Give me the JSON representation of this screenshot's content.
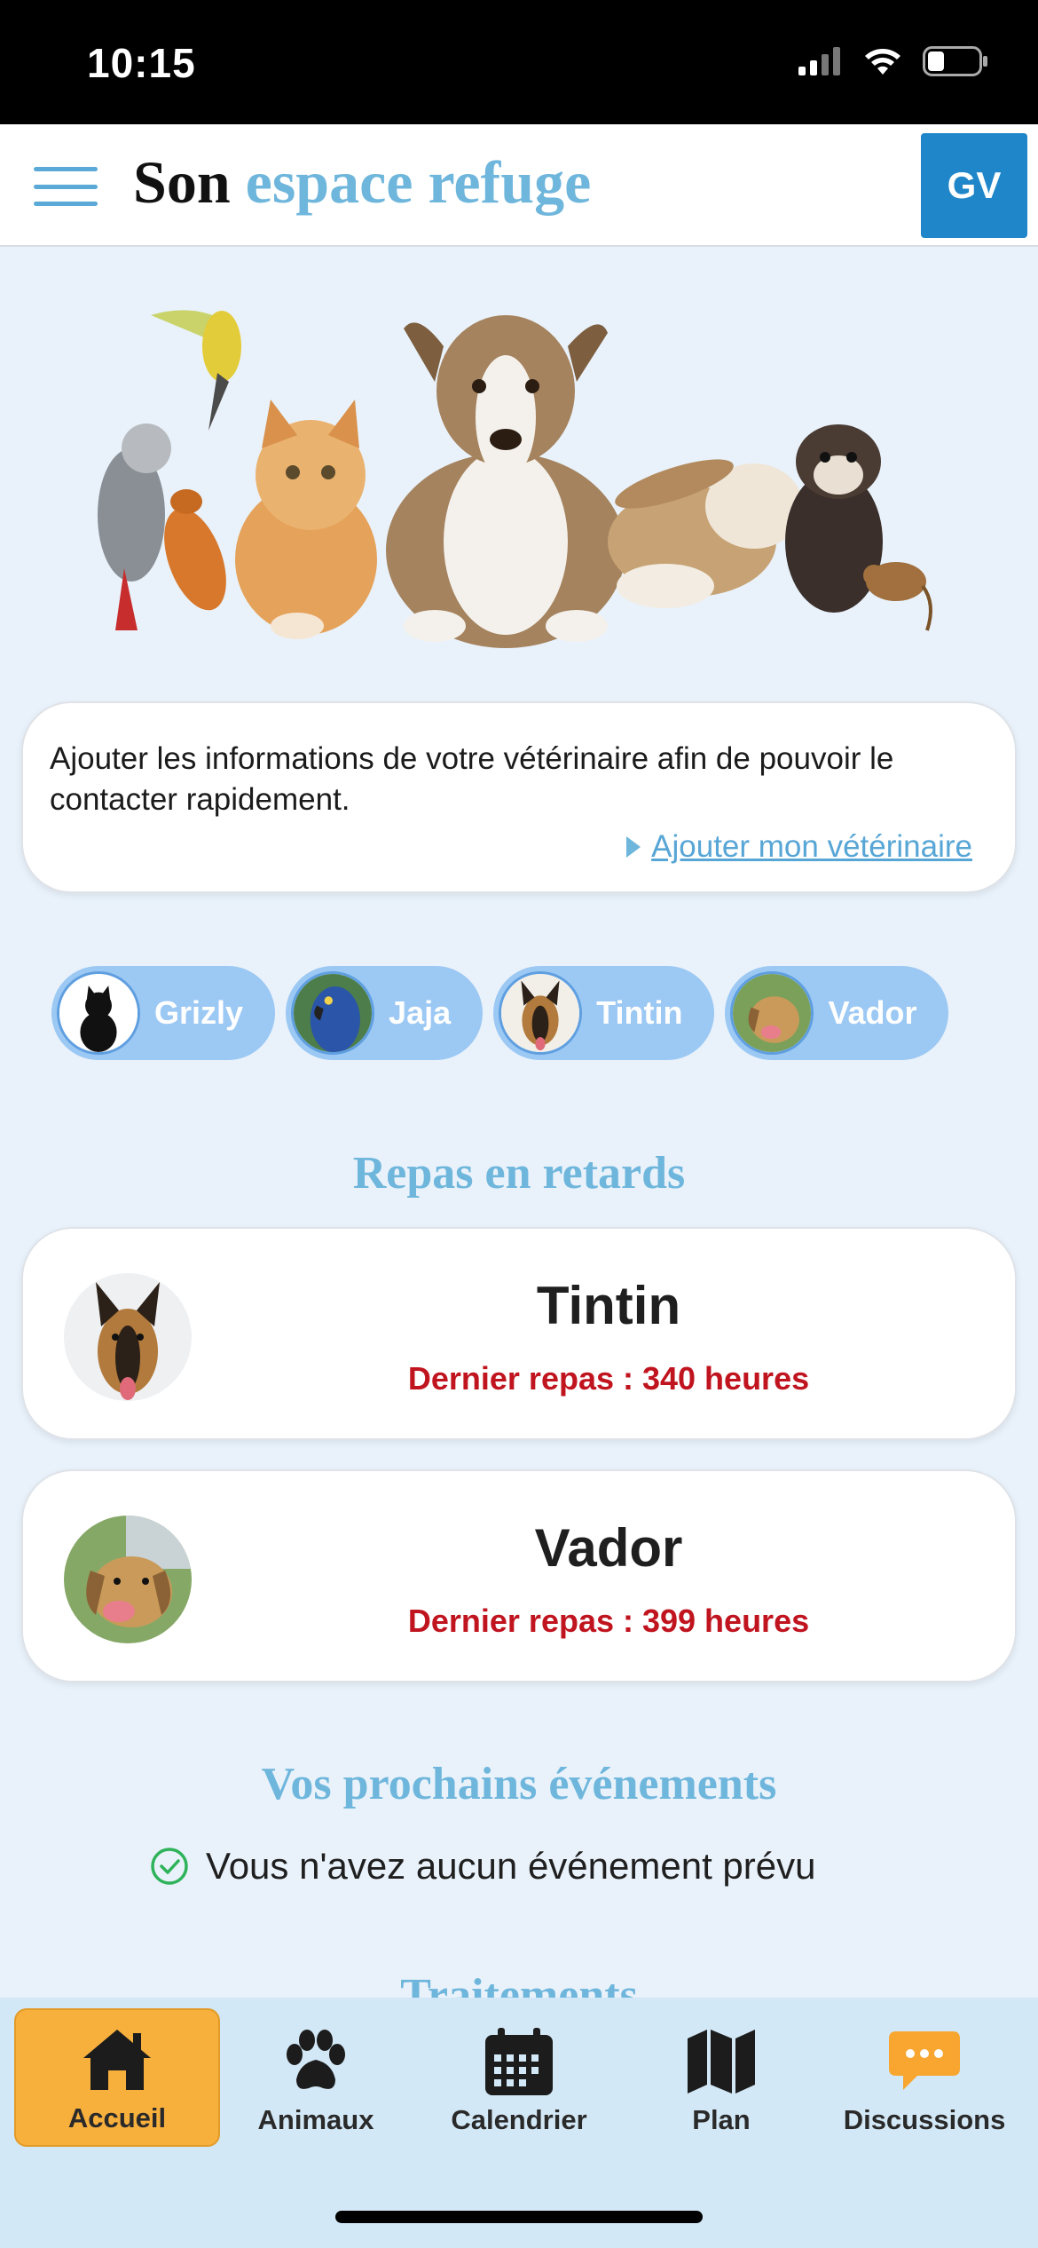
{
  "status_bar": {
    "time": "10:15"
  },
  "header": {
    "title_part1": "Son",
    "title_part2": "espace refuge",
    "avatar_initials": "GV"
  },
  "vet_card": {
    "text": "Ajouter les informations de votre vétérinaire afin de pouvoir le contacter rapidement.",
    "link": "Ajouter mon vétérinaire"
  },
  "pets": [
    {
      "name": "Grizly"
    },
    {
      "name": "Jaja"
    },
    {
      "name": "Tintin"
    },
    {
      "name": "Vador"
    }
  ],
  "late_meals": {
    "title": "Repas en retards",
    "items": [
      {
        "name": "Tintin",
        "status": "Dernier repas : 340 heures"
      },
      {
        "name": "Vador",
        "status": "Dernier repas : 399 heures"
      }
    ]
  },
  "events": {
    "title": "Vos prochains événements",
    "empty_text": "Vous n'avez aucun événement prévu"
  },
  "next_section_title_partial": "Traitements",
  "nav": {
    "items": [
      {
        "label": "Accueil",
        "icon": "home-icon",
        "active": true
      },
      {
        "label": "Animaux",
        "icon": "paw-icon"
      },
      {
        "label": "Calendrier",
        "icon": "calendar-icon"
      },
      {
        "label": "Plan",
        "icon": "map-icon"
      },
      {
        "label": "Discussions",
        "icon": "chat-icon"
      }
    ]
  },
  "colors": {
    "accent_blue": "#6fb6dc",
    "avatar_blue": "#1f86c9",
    "chip_blue": "#9cc8f4",
    "alert_red": "#c0141f",
    "active_nav_orange": "#f8b03d",
    "nav_background": "#d3e8f6",
    "page_background": "#e9f2fb"
  }
}
